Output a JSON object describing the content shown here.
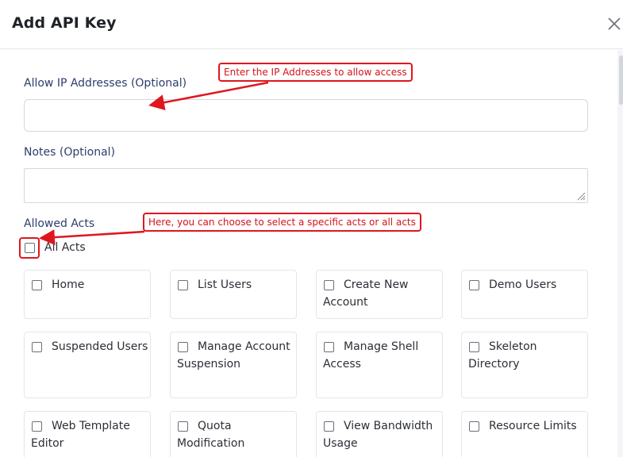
{
  "modal": {
    "title": "Add API Key",
    "close_icon": "close-icon"
  },
  "fields": {
    "ip_label": "Allow IP Addresses (Optional)",
    "ip_value": "",
    "notes_label": "Notes (Optional)",
    "notes_value": "",
    "acts_label": "Allowed Acts",
    "all_acts_label": "All Acts"
  },
  "acts": [
    [
      "Home",
      "List Users",
      "Create New Account",
      "Demo Users"
    ],
    [
      "Suspended Users",
      "Manage Account Suspension",
      "Manage Shell Access",
      "Skeleton Directory"
    ],
    [
      "Web Template Editor",
      "Quota Modification",
      "View Bandwidth Usage",
      "Resource Limits"
    ]
  ],
  "annotations": {
    "ip_callout": "Enter the IP Addresses to allow access",
    "acts_callout": "Here, you can choose to select a specific acts or all acts",
    "color": "#e0161e"
  }
}
